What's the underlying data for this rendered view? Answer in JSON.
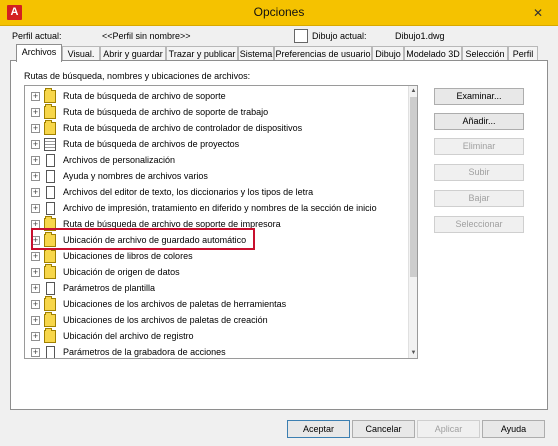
{
  "window": {
    "title": "Opciones",
    "app_icon_letter": "A",
    "close_glyph": "✕"
  },
  "header": {
    "profile_label": "Perfil actual:",
    "profile_value": "<<Perfil sin nombre>>",
    "drawing_label": "Dibujo actual:",
    "drawing_value": "Dibujo1.dwg"
  },
  "tabs": [
    {
      "label": "Archivos",
      "active": true
    },
    {
      "label": "Visual.",
      "active": false
    },
    {
      "label": "Abrir y guardar",
      "active": false
    },
    {
      "label": "Trazar y publicar",
      "active": false
    },
    {
      "label": "Sistema",
      "active": false
    },
    {
      "label": "Preferencias de usuario",
      "active": false
    },
    {
      "label": "Dibujo",
      "active": false
    },
    {
      "label": "Modelado 3D",
      "active": false
    },
    {
      "label": "Selección",
      "active": false
    },
    {
      "label": "Perfil",
      "active": false
    }
  ],
  "section_label": "Rutas de búsqueda, nombres y ubicaciones de archivos:",
  "tree_items": [
    {
      "label": "Ruta de búsqueda de archivo de soporte",
      "icon": "folder-icon"
    },
    {
      "label": "Ruta de búsqueda de archivo de soporte de trabajo",
      "icon": "folder-icon"
    },
    {
      "label": "Ruta de búsqueda de archivo de controlador de dispositivos",
      "icon": "folder-icon"
    },
    {
      "label": "Ruta de búsqueda de archivos de proyectos",
      "icon": "list-document-icon"
    },
    {
      "label": "Archivos de personalización",
      "icon": "document-icon"
    },
    {
      "label": "Ayuda y nombres de archivos varios",
      "icon": "document-icon"
    },
    {
      "label": "Archivos del editor de texto, los diccionarios y los tipos de letra",
      "icon": "document-icon"
    },
    {
      "label": "Archivo de impresión, tratamiento en diferido y nombres de la sección de inicio",
      "icon": "document-icon"
    },
    {
      "label": "Ruta de búsqueda de archivo de soporte de impresora",
      "icon": "folder-icon"
    },
    {
      "label": "Ubicación de archivo de guardado automático",
      "icon": "folder-icon"
    },
    {
      "label": "Ubicaciones de libros de colores",
      "icon": "folder-icon"
    },
    {
      "label": "Ubicación de origen de datos",
      "icon": "folder-icon"
    },
    {
      "label": "Parámetros de plantilla",
      "icon": "document-icon"
    },
    {
      "label": "Ubicaciones de los archivos de paletas de herramientas",
      "icon": "folder-icon"
    },
    {
      "label": "Ubicaciones de los archivos de paletas de creación",
      "icon": "folder-icon"
    },
    {
      "label": "Ubicación del archivo de registro",
      "icon": "folder-icon"
    },
    {
      "label": "Parámetros de la grabadora de acciones",
      "icon": "document-icon"
    }
  ],
  "expander_glyph": "+",
  "scroll": {
    "up_glyph": "▲",
    "down_glyph": "▼"
  },
  "side_buttons": [
    {
      "label": "Examinar...",
      "enabled": true
    },
    {
      "label": "Añadir...",
      "enabled": true
    },
    {
      "label": "Eliminar",
      "enabled": false
    },
    {
      "label": "Subir",
      "enabled": false
    },
    {
      "label": "Bajar",
      "enabled": false
    },
    {
      "label": "Seleccionar",
      "enabled": false
    }
  ],
  "footer_buttons": [
    {
      "label": "Aceptar",
      "enabled": true
    },
    {
      "label": "Cancelar",
      "enabled": true
    },
    {
      "label": "Aplicar",
      "enabled": false
    },
    {
      "label": "Ayuda",
      "enabled": true
    }
  ],
  "colors": {
    "titlebar": "#f5c200",
    "highlight_box": "#c8102e",
    "folder": "#f7d64a"
  }
}
